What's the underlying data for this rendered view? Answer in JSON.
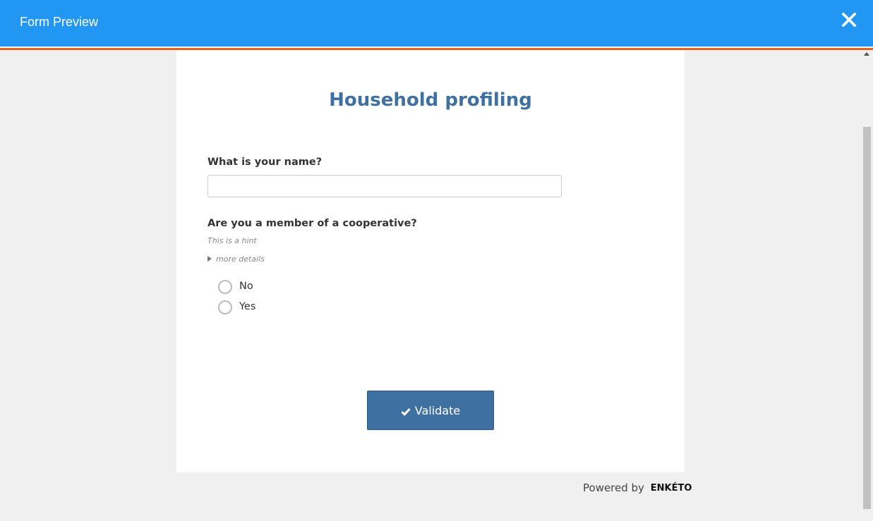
{
  "header": {
    "title": "Form Preview",
    "close_icon": "close-icon",
    "color": "#2196f3",
    "accent_stripe": "#e8621b"
  },
  "form": {
    "title": "Household profiling",
    "title_color": "#3e71a1",
    "questions": [
      {
        "label": "What is your name?",
        "type": "text",
        "value": ""
      },
      {
        "label": "Are you a member of a cooperative?",
        "hint": "This is a hint",
        "more_details": "more details",
        "type": "select_one",
        "options": [
          "No",
          "Yes"
        ],
        "selected": null
      }
    ],
    "validate_label": "Validate",
    "validate_icon": "check-icon"
  },
  "footer": {
    "powered_by": "Powered by",
    "brand": "ENKÉTO"
  }
}
